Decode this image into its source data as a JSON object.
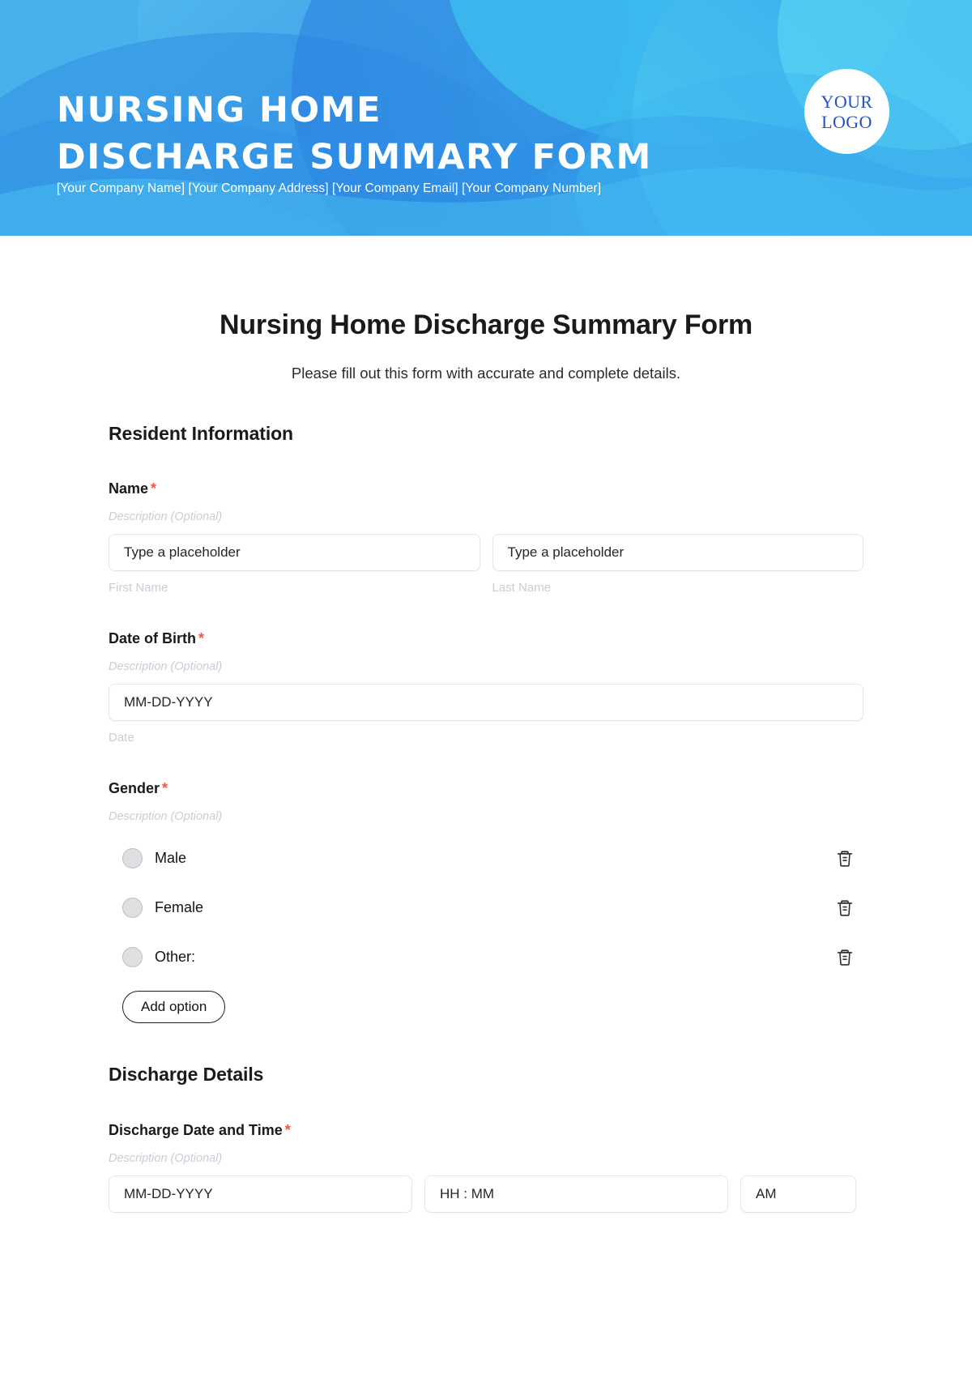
{
  "banner": {
    "title_line1": "Nursing Home",
    "title_line2": "Discharge Summary Form",
    "company_line": "[Your Company Name] [Your Company Address] [Your Company Email] [Your Company Number]",
    "logo_line1": "YOUR",
    "logo_line2": "LOGO",
    "gradient_start": "#45aeea",
    "gradient_end": "#35bdf0",
    "logo_text_color": "#2451c4"
  },
  "page": {
    "title": "Nursing Home Discharge Summary Form",
    "subtitle": "Please fill out this form with accurate and complete details.",
    "required_marker": "*",
    "required_color": "#f4553d",
    "description_placeholder": "Description (Optional)"
  },
  "sections": [
    {
      "heading": "Resident Information"
    },
    {
      "heading": "Discharge Details"
    }
  ],
  "fields": {
    "name": {
      "label": "Name",
      "description": "Description (Optional)",
      "first": {
        "placeholder": "Type a placeholder",
        "sublabel": "First Name"
      },
      "last": {
        "placeholder": "Type a placeholder",
        "sublabel": "Last Name"
      }
    },
    "dob": {
      "label": "Date of Birth",
      "description": "Description (Optional)",
      "placeholder": "MM-DD-YYYY",
      "sublabel": "Date"
    },
    "gender": {
      "label": "Gender",
      "description": "Description (Optional)",
      "options": [
        {
          "label": "Male"
        },
        {
          "label": "Female"
        },
        {
          "label": "Other:"
        }
      ],
      "add_option_label": "Add option",
      "delete_icon": "trash-icon"
    },
    "discharge_datetime": {
      "label": "Discharge Date and Time",
      "description": "Description (Optional)",
      "date_placeholder": "MM-DD-YYYY",
      "time_placeholder": "HH : MM",
      "meridiem_value": "AM"
    }
  }
}
